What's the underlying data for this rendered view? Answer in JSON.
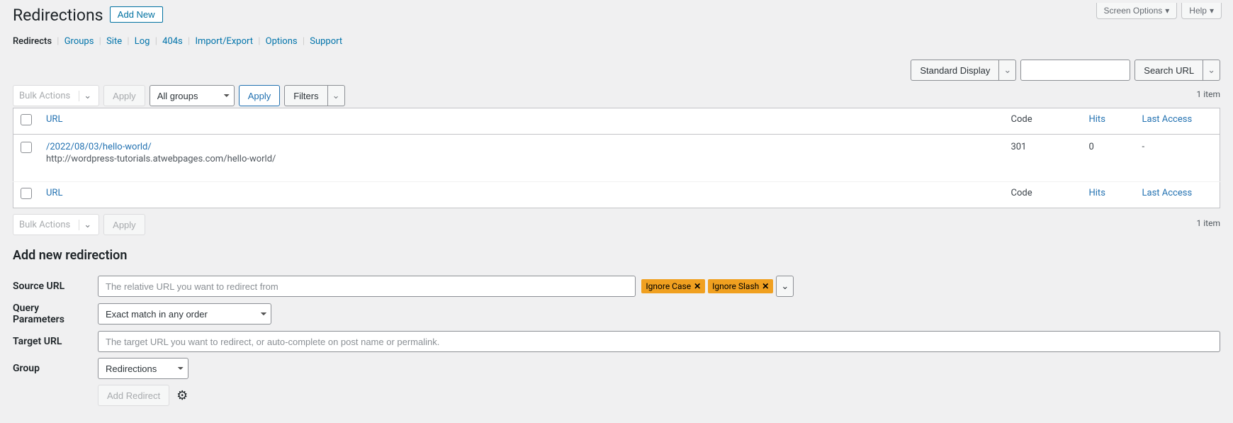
{
  "topRight": {
    "screenOptions": "Screen Options",
    "help": "Help"
  },
  "header": {
    "title": "Redirections",
    "addNew": "Add New"
  },
  "subnav": {
    "current": "Redirects",
    "items": [
      "Groups",
      "Site",
      "Log",
      "404s",
      "Import/Export",
      "Options",
      "Support"
    ]
  },
  "rightDisplay": {
    "standardDisplay": "Standard Display",
    "searchUrl": "Search URL"
  },
  "filters": {
    "bulkActions": "Bulk Actions",
    "apply": "Apply",
    "allGroups": "All groups",
    "filters": "Filters"
  },
  "count": "1 item",
  "table": {
    "cols": {
      "url": "URL",
      "code": "Code",
      "hits": "Hits",
      "last": "Last Access"
    },
    "rows": [
      {
        "source": "/2022/08/03/hello-world/",
        "target": "http://wordpress-tutorials.atwebpages.com/hello-world/",
        "code": "301",
        "hits": "0",
        "last": "-"
      }
    ]
  },
  "form": {
    "heading": "Add new redirection",
    "sourceLabel": "Source URL",
    "sourcePlaceholder": "The relative URL you want to redirect from",
    "flags": {
      "ignoreCase": "Ignore Case",
      "ignoreSlash": "Ignore Slash"
    },
    "queryLabel": "Query Parameters",
    "queryValue": "Exact match in any order",
    "targetLabel": "Target URL",
    "targetPlaceholder": "The target URL you want to redirect, or auto-complete on post name or permalink.",
    "groupLabel": "Group",
    "groupValue": "Redirections",
    "addRedirect": "Add Redirect"
  }
}
